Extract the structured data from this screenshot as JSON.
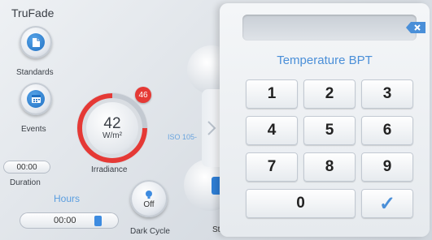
{
  "app": {
    "title": "TruFade"
  },
  "left": {
    "standards_label": "Standards",
    "events_label": "Events",
    "duration_value": "00:00",
    "duration_label": "Duration",
    "hours_label": "Hours",
    "hours_value": "00:00"
  },
  "irradiance": {
    "value": "42",
    "unit": "W/m²",
    "label": "Irradiance",
    "badge": "46",
    "iso_partial": "ISO 105-"
  },
  "dark_cycle": {
    "state": "Off",
    "label": "Dark Cycle"
  },
  "start_partial": "St",
  "keypad": {
    "title": "Temperature  BPT",
    "display_value": "",
    "keys": [
      "1",
      "2",
      "3",
      "4",
      "5",
      "6",
      "7",
      "8",
      "9",
      "0"
    ],
    "confirm_glyph": "✓"
  },
  "colors": {
    "accent": "#4a8fd8",
    "badge": "#e53935",
    "dial_arc": "#e53935"
  },
  "icons": {
    "standards": "document-icon",
    "events": "calendar-icon",
    "hours": "battery-icon",
    "dark_cycle": "lightbulb-icon",
    "backspace": "backspace-icon",
    "confirm": "checkmark-icon",
    "chevron": "chevron-right-icon"
  }
}
